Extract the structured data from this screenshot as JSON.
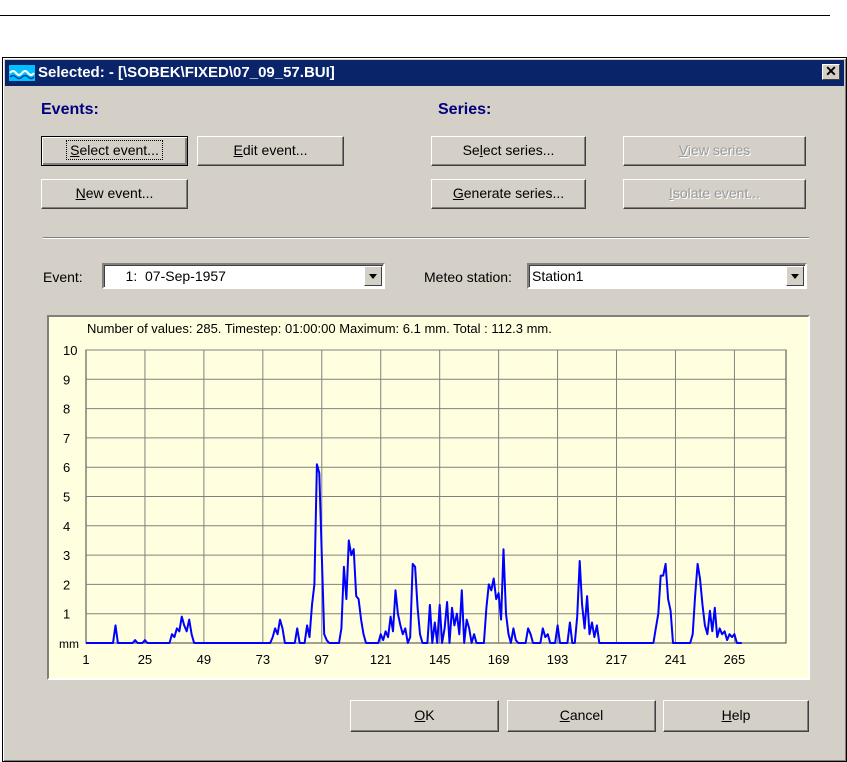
{
  "dialog": {
    "title": "Selected: - [\\SOBEK\\FIXED\\07_09_57.BUI]",
    "close_symbol": "✕",
    "icon": "wave-icon"
  },
  "events": {
    "heading": "Events:",
    "select_event": {
      "key": "S",
      "rest": "elect event..."
    },
    "edit_event": {
      "key": "E",
      "rest": "dit event..."
    },
    "new_event": {
      "key": "N",
      "rest": "ew event..."
    }
  },
  "series": {
    "heading": "Series:",
    "select_series": {
      "pre": "Se",
      "key": "l",
      "rest": "ect series..."
    },
    "view_series": {
      "key": "V",
      "rest": "iew series"
    },
    "generate_series": {
      "key": "G",
      "rest": "enerate series..."
    },
    "isolate_event": {
      "key": "I",
      "rest": "solate event..."
    }
  },
  "event_field": {
    "label": "Event:",
    "value": "    1:  07-Sep-1957"
  },
  "meteo_field": {
    "label": "Meteo station:",
    "value": "Station1"
  },
  "chart_info": "Number of values: 285.  Timestep: 01:00:00  Maximum: 6.1 mm.  Total : 112.3 mm.",
  "footer": {
    "ok": {
      "key": "O",
      "rest": "K"
    },
    "cancel": {
      "key": "C",
      "rest": "ancel"
    },
    "help": {
      "key": "H",
      "rest": "elp"
    }
  },
  "colors": {
    "title_bar": "#0a246a",
    "dialog_bg": "#d4d0c8",
    "chart_bg": "#ffffe0",
    "series": "#0000ff",
    "heading": "#00007b"
  },
  "chart_data": {
    "type": "line",
    "title": "",
    "xlabel": "",
    "ylabel": "mm",
    "xlim": [
      1,
      286
    ],
    "ylim": [
      0,
      10
    ],
    "x_ticks": [
      1,
      25,
      49,
      73,
      97,
      121,
      145,
      169,
      193,
      217,
      241,
      265
    ],
    "y_ticks": [
      1,
      2,
      3,
      4,
      5,
      6,
      7,
      8,
      9,
      10
    ],
    "grid": true,
    "series": [
      {
        "name": "",
        "color": "#0000ff",
        "points": [
          [
            1,
            0
          ],
          [
            12,
            0
          ],
          [
            13,
            0.6
          ],
          [
            14,
            0
          ],
          [
            20,
            0
          ],
          [
            21,
            0.1
          ],
          [
            22,
            0
          ],
          [
            24,
            0
          ],
          [
            25,
            0.1
          ],
          [
            26,
            0
          ],
          [
            35,
            0
          ],
          [
            36,
            0.3
          ],
          [
            37,
            0.2
          ],
          [
            38,
            0.5
          ],
          [
            39,
            0.4
          ],
          [
            40,
            0.9
          ],
          [
            41,
            0.6
          ],
          [
            42,
            0.4
          ],
          [
            43,
            0.8
          ],
          [
            44,
            0.3
          ],
          [
            45,
            0
          ],
          [
            76,
            0
          ],
          [
            77,
            0.2
          ],
          [
            78,
            0.5
          ],
          [
            79,
            0.3
          ],
          [
            80,
            0.8
          ],
          [
            81,
            0.5
          ],
          [
            82,
            0
          ],
          [
            86,
            0
          ],
          [
            87,
            0.5
          ],
          [
            88,
            0
          ],
          [
            90,
            0
          ],
          [
            91,
            0.6
          ],
          [
            92,
            0.2
          ],
          [
            93,
            1.3
          ],
          [
            94,
            2.0
          ],
          [
            95,
            6.1
          ],
          [
            96,
            5.8
          ],
          [
            97,
            3.0
          ],
          [
            98,
            0.3
          ],
          [
            99,
            0.1
          ],
          [
            100,
            0
          ],
          [
            104,
            0
          ],
          [
            105,
            0.5
          ],
          [
            106,
            2.6
          ],
          [
            107,
            1.5
          ],
          [
            108,
            3.5
          ],
          [
            109,
            3.0
          ],
          [
            110,
            3.2
          ],
          [
            111,
            1.6
          ],
          [
            112,
            1.5
          ],
          [
            113,
            0.8
          ],
          [
            114,
            0.3
          ],
          [
            115,
            0
          ],
          [
            120,
            0
          ],
          [
            121,
            0.3
          ],
          [
            122,
            0.1
          ],
          [
            123,
            0.4
          ],
          [
            124,
            0.2
          ],
          [
            125,
            0.9
          ],
          [
            126,
            0.4
          ],
          [
            127,
            1.8
          ],
          [
            128,
            1.0
          ],
          [
            129,
            0.6
          ],
          [
            130,
            0.3
          ],
          [
            131,
            0.5
          ],
          [
            132,
            0
          ],
          [
            133,
            0.2
          ],
          [
            134,
            2.7
          ],
          [
            135,
            2.6
          ],
          [
            136,
            1.2
          ],
          [
            137,
            0.3
          ],
          [
            138,
            0
          ],
          [
            140,
            0
          ],
          [
            141,
            1.3
          ],
          [
            142,
            0
          ],
          [
            143,
            0.7
          ],
          [
            144,
            0
          ],
          [
            145,
            1.3
          ],
          [
            146,
            0
          ],
          [
            147,
            0.5
          ],
          [
            148,
            1.4
          ],
          [
            149,
            0
          ],
          [
            150,
            1.2
          ],
          [
            151,
            0.6
          ],
          [
            152,
            1.0
          ],
          [
            153,
            0.3
          ],
          [
            154,
            1.8
          ],
          [
            155,
            0
          ],
          [
            156,
            0.8
          ],
          [
            157,
            0.5
          ],
          [
            158,
            0
          ],
          [
            159,
            0.3
          ],
          [
            160,
            0
          ],
          [
            163,
            0
          ],
          [
            164,
            1.2
          ],
          [
            165,
            2.0
          ],
          [
            166,
            1.8
          ],
          [
            167,
            2.2
          ],
          [
            168,
            1.5
          ],
          [
            169,
            1.7
          ],
          [
            170,
            0.8
          ],
          [
            171,
            3.2
          ],
          [
            172,
            1.0
          ],
          [
            173,
            0.3
          ],
          [
            174,
            0
          ],
          [
            175,
            0.5
          ],
          [
            176,
            0.1
          ],
          [
            177,
            0
          ],
          [
            180,
            0
          ],
          [
            181,
            0.5
          ],
          [
            182,
            0.3
          ],
          [
            183,
            0
          ],
          [
            186,
            0
          ],
          [
            187,
            0.5
          ],
          [
            188,
            0.2
          ],
          [
            189,
            0.3
          ],
          [
            190,
            0
          ],
          [
            192,
            0
          ],
          [
            193,
            0.6
          ],
          [
            194,
            0
          ],
          [
            197,
            0
          ],
          [
            198,
            0.7
          ],
          [
            199,
            0
          ],
          [
            200,
            0
          ],
          [
            201,
            0.9
          ],
          [
            202,
            2.8
          ],
          [
            203,
            1.3
          ],
          [
            204,
            0.5
          ],
          [
            205,
            1.6
          ],
          [
            206,
            0.3
          ],
          [
            207,
            0.7
          ],
          [
            208,
            0.2
          ],
          [
            209,
            0.6
          ],
          [
            210,
            0
          ],
          [
            232,
            0
          ],
          [
            233,
            0.5
          ],
          [
            234,
            1.0
          ],
          [
            235,
            2.3
          ],
          [
            236,
            2.3
          ],
          [
            237,
            2.7
          ],
          [
            238,
            1.5
          ],
          [
            239,
            1.1
          ],
          [
            240,
            0
          ],
          [
            247,
            0
          ],
          [
            248,
            0.3
          ],
          [
            249,
            1.6
          ],
          [
            250,
            2.7
          ],
          [
            251,
            2.2
          ],
          [
            252,
            1.3
          ],
          [
            253,
            0.6
          ],
          [
            254,
            0.3
          ],
          [
            255,
            1.1
          ],
          [
            256,
            0.4
          ],
          [
            257,
            1.2
          ],
          [
            258,
            0.2
          ],
          [
            259,
            0.5
          ],
          [
            260,
            0.3
          ],
          [
            261,
            0.4
          ],
          [
            262,
            0.1
          ],
          [
            263,
            0.3
          ],
          [
            264,
            0.2
          ],
          [
            265,
            0.3
          ],
          [
            266,
            0
          ],
          [
            268,
            0
          ]
        ]
      }
    ]
  }
}
